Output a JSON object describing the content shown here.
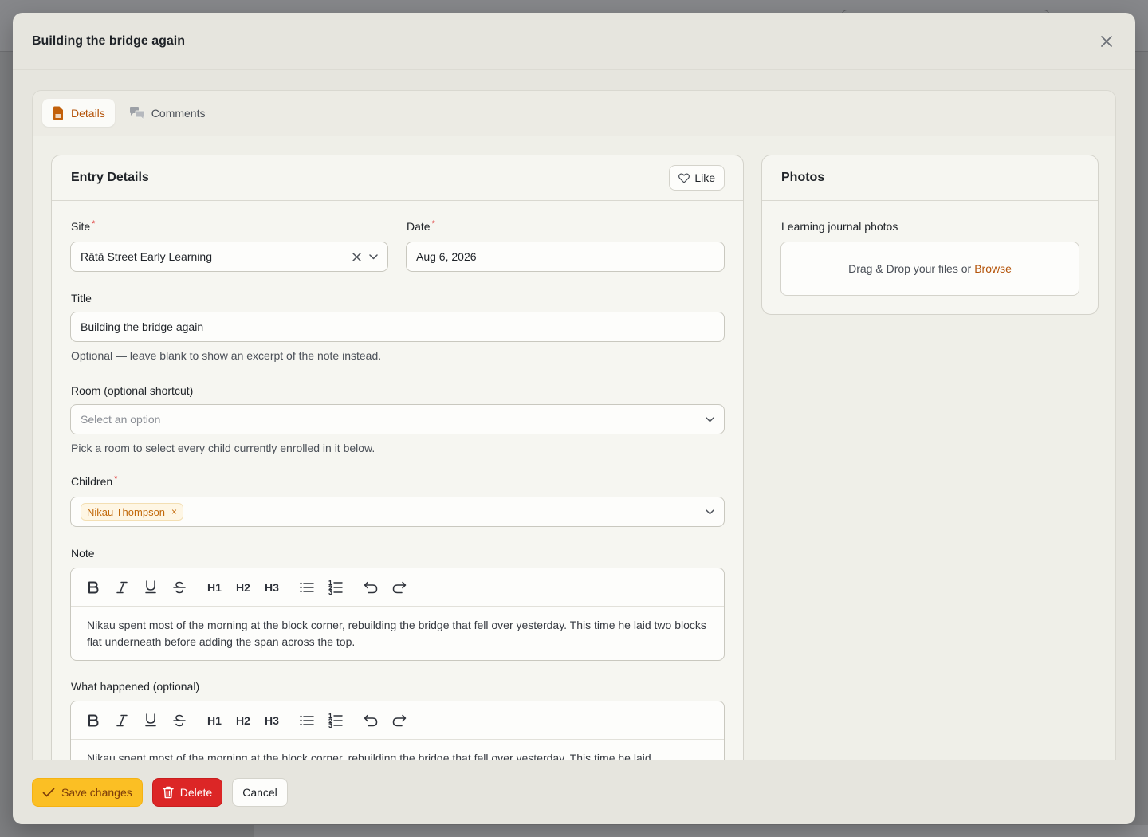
{
  "modal": {
    "title": "Building the bridge again",
    "tabs": [
      {
        "label": "Details",
        "icon": "document-icon",
        "active": true
      },
      {
        "label": "Comments",
        "icon": "chat-bubbles-icon",
        "active": false
      }
    ]
  },
  "entry_details": {
    "heading": "Entry Details",
    "like_label": "Like",
    "site": {
      "label": "Site",
      "required_mark": "*",
      "value": "Rātā Street Early Learning"
    },
    "date": {
      "label": "Date",
      "required_mark": "*",
      "value": "Aug 6, 2026"
    },
    "title_field": {
      "label": "Title",
      "value": "Building the bridge again",
      "hint": "Optional — leave blank to show an excerpt of the note instead."
    },
    "room": {
      "label": "Room (optional shortcut)",
      "placeholder": "Select an option",
      "hint": "Pick a room to select every child currently enrolled in it below."
    },
    "children": {
      "label": "Children",
      "required_mark": "*",
      "chips": [
        "Nikau Thompson"
      ],
      "chip_remove": "×"
    },
    "note": {
      "label": "Note",
      "text": "Nikau spent most of the morning at the block corner, rebuilding the bridge that fell over yesterday. This time he laid two blocks flat underneath before adding the span across the top."
    },
    "what_happened": {
      "label": "What happened (optional)",
      "text": "Nikau spent most of the morning at the block corner, rebuilding the bridge that fell over yesterday. This time he laid"
    },
    "toolbar": {
      "bold": "B",
      "italic": "I",
      "underline": "U",
      "strike": "S",
      "h1": "H1",
      "h2": "H2",
      "h3": "H3"
    }
  },
  "photos": {
    "heading": "Photos",
    "label": "Learning journal photos",
    "drop_text": "Drag & Drop your files or",
    "browse": "Browse"
  },
  "footer": {
    "save": "Save changes",
    "delete": "Delete",
    "cancel": "Cancel"
  },
  "colors": {
    "accent": "#b45309",
    "save_bg": "#fbbf24",
    "delete_bg": "#dc2626",
    "required": "#dc2626"
  }
}
